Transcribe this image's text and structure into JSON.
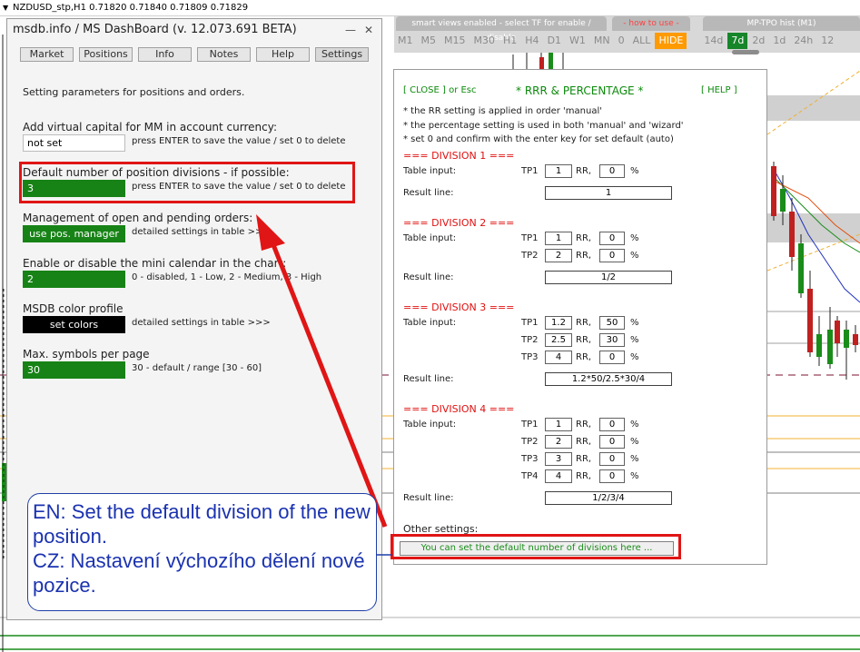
{
  "chart": {
    "title": "NZDUSD_stp,H1  0.71820 0.71840 0.71809 0.71829"
  },
  "tfbar": {
    "header_left": "smart views enabled - select TF for enable / disable",
    "header_mid": "- how to use -",
    "header_right": "MP-TPO hist (M1)",
    "buttons": [
      {
        "label": "M1",
        "state": "normal"
      },
      {
        "label": "M5",
        "state": "normal"
      },
      {
        "label": "M15",
        "state": "normal"
      },
      {
        "label": "M30",
        "state": "normal"
      },
      {
        "label": "H1",
        "state": "normal"
      },
      {
        "label": "H4",
        "state": "normal"
      },
      {
        "label": "D1",
        "state": "normal"
      },
      {
        "label": "W1",
        "state": "normal"
      },
      {
        "label": "MN",
        "state": "normal"
      },
      {
        "label": "0",
        "state": "normal"
      },
      {
        "label": "ALL",
        "state": "normal"
      },
      {
        "label": "HIDE",
        "state": "hide"
      },
      {
        "label": "14d",
        "state": "normal"
      },
      {
        "label": "7d",
        "state": "active"
      },
      {
        "label": "2d",
        "state": "normal"
      },
      {
        "label": "1d",
        "state": "normal"
      },
      {
        "label": "24h",
        "state": "normal"
      },
      {
        "label": "12",
        "state": "normal"
      }
    ]
  },
  "panel": {
    "title": "msdb.info / MS DashBoard (v. 12.073.691 BETA)",
    "minimize": "—",
    "close": "✕",
    "tabs": [
      "Market",
      "Positions",
      "Info",
      "Notes",
      "Help",
      "Settings"
    ],
    "intro": "Setting parameters for positions and orders.",
    "settings": [
      {
        "label": "Add virtual capital for MM in account currency:",
        "value": "not set",
        "hint": "press ENTER to save the value / set 0 to delete"
      },
      {
        "label": "Default number of position divisions - if possible:",
        "value": "3",
        "hint": "press ENTER to save the value / set 0 to delete"
      },
      {
        "label": "Management of open and pending orders:",
        "value": "use pos. manager",
        "hint": "detailed settings in table >>>"
      },
      {
        "label": "Enable or disable the mini calendar in the chart:",
        "value": "2",
        "hint": "0 - disabled, 1 - Low, 2 - Medium, 3 - High"
      },
      {
        "label": "MSDB color profile",
        "value": "set colors",
        "hint": "detailed settings in table >>>"
      },
      {
        "label": "Max. symbols per page",
        "value": "30",
        "hint": "30 - default / range [30 - 60]"
      }
    ]
  },
  "rrr": {
    "close": "[ CLOSE ] or Esc",
    "title": "* RRR & PERCENTAGE *",
    "help": "[ HELP ]",
    "notes": [
      "* the RR setting is applied in order 'manual'",
      "* the percentage setting is used in both 'manual' and 'wizard'",
      "* set 0 and confirm with the enter key for set default (auto)"
    ],
    "table_input": "Table input:",
    "result_line": "Result line:",
    "rr": "RR,",
    "pct": "%",
    "divisions": [
      {
        "title": "===  DIVISION 1  ===",
        "rows": [
          {
            "tp": "TP1",
            "rr": "1",
            "pct": "0"
          }
        ],
        "result": "1"
      },
      {
        "title": "===  DIVISION 2  ===",
        "rows": [
          {
            "tp": "TP1",
            "rr": "1",
            "pct": "0"
          },
          {
            "tp": "TP2",
            "rr": "2",
            "pct": "0"
          }
        ],
        "result": "1/2"
      },
      {
        "title": "===  DIVISION 3  ===",
        "rows": [
          {
            "tp": "TP1",
            "rr": "1.2",
            "pct": "50"
          },
          {
            "tp": "TP2",
            "rr": "2.5",
            "pct": "30"
          },
          {
            "tp": "TP3",
            "rr": "4",
            "pct": "0"
          }
        ],
        "result": "1.2*50/2.5*30/4"
      },
      {
        "title": "===  DIVISION 4  ===",
        "rows": [
          {
            "tp": "TP1",
            "rr": "1",
            "pct": "0"
          },
          {
            "tp": "TP2",
            "rr": "2",
            "pct": "0"
          },
          {
            "tp": "TP3",
            "rr": "3",
            "pct": "0"
          },
          {
            "tp": "TP4",
            "rr": "4",
            "pct": "0"
          }
        ],
        "result": "1/2/3/4"
      }
    ],
    "other_settings": "Other settings:",
    "default_divisions_button": "You can set the default number of divisions here ..."
  },
  "callout": {
    "en": "EN: Set the default division of the new position.",
    "cz": "CZ: Nastavení výchozího dělení nové pozice."
  },
  "colors": {
    "green_field": "#178316",
    "highlight_red": "#e01515",
    "callout_blue": "#1a32b0",
    "hide_orange": "#ff9a00"
  }
}
